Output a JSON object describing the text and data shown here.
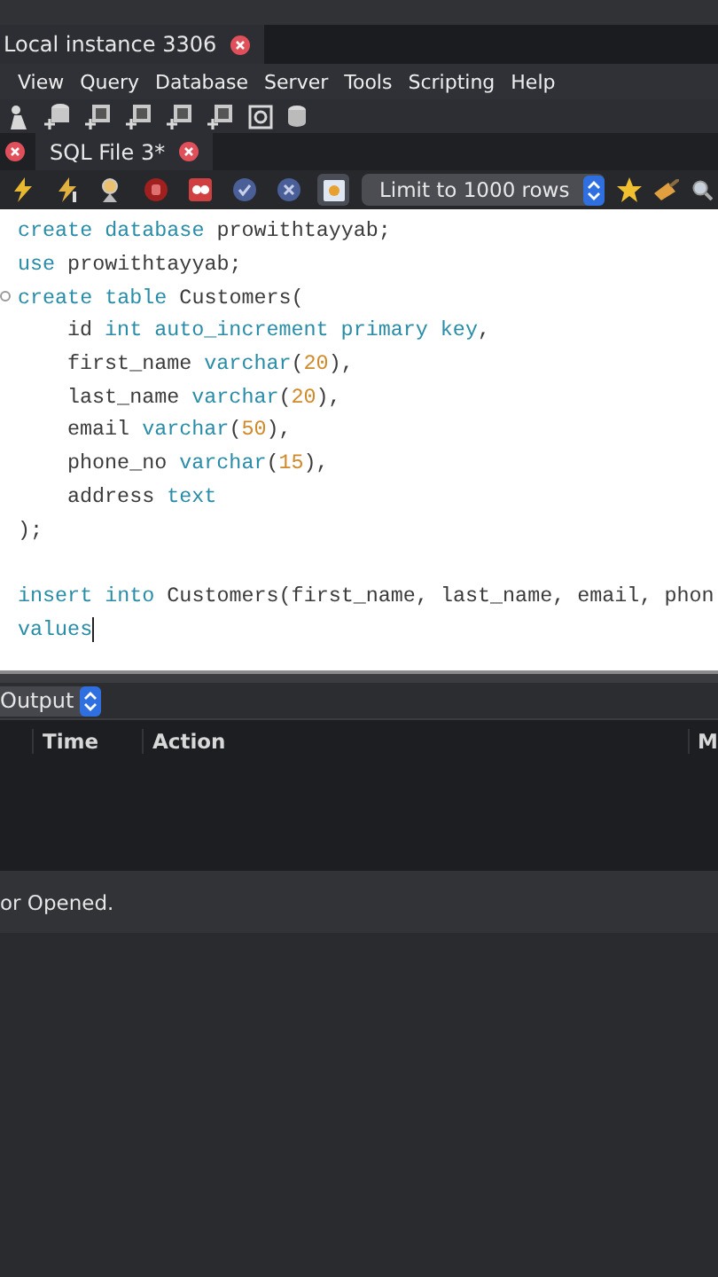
{
  "instance_tab": {
    "title": "Local instance 3306"
  },
  "menu": [
    "View",
    "Query",
    "Database",
    "Server",
    "Tools",
    "Scripting",
    "Help"
  ],
  "main_toolbar": [
    {
      "kind": "person"
    },
    {
      "kind": "db-add"
    },
    {
      "kind": "table-add"
    },
    {
      "kind": "view-add"
    },
    {
      "kind": "proc-add"
    },
    {
      "kind": "func-add"
    },
    {
      "kind": "inspect"
    },
    {
      "kind": "db"
    }
  ],
  "file_tab": {
    "title": "SQL File 3*"
  },
  "editor_toolbar": [
    {
      "kind": "bolt",
      "pressed": false
    },
    {
      "kind": "bolt-cursor",
      "pressed": false
    },
    {
      "kind": "explain",
      "pressed": false
    },
    {
      "kind": "stop",
      "pressed": false
    },
    {
      "kind": "error",
      "pressed": false
    },
    {
      "kind": "commit",
      "pressed": false
    },
    {
      "kind": "rollback",
      "pressed": false
    },
    {
      "kind": "autocommit",
      "pressed": true
    }
  ],
  "limit_select": {
    "value": "Limit to 1000 rows"
  },
  "editor_tools": [
    {
      "kind": "star"
    },
    {
      "kind": "broom"
    },
    {
      "kind": "search"
    }
  ],
  "code": [
    {
      "indent": false,
      "tokens": [
        {
          "kind": "kw",
          "text": "create database"
        },
        {
          "kind": "plain",
          "text": " prowithtayyab;"
        }
      ]
    },
    {
      "indent": false,
      "tokens": [
        {
          "kind": "kw",
          "text": "use"
        },
        {
          "kind": "plain",
          "text": " prowithtayyab;"
        }
      ]
    },
    {
      "indent": false,
      "fold": true,
      "tokens": [
        {
          "kind": "kw",
          "text": "create table"
        },
        {
          "kind": "plain",
          "text": " Customers("
        }
      ]
    },
    {
      "indent": true,
      "tokens": [
        {
          "kind": "plain",
          "text": "id "
        },
        {
          "kind": "kw",
          "text": "int auto_increment primary key"
        },
        {
          "kind": "plain",
          "text": ","
        }
      ]
    },
    {
      "indent": true,
      "tokens": [
        {
          "kind": "plain",
          "text": "first_name "
        },
        {
          "kind": "kw",
          "text": "varchar"
        },
        {
          "kind": "plain",
          "text": "("
        },
        {
          "kind": "num",
          "text": "20"
        },
        {
          "kind": "plain",
          "text": "),"
        }
      ]
    },
    {
      "indent": true,
      "tokens": [
        {
          "kind": "plain",
          "text": "last_name "
        },
        {
          "kind": "kw",
          "text": "varchar"
        },
        {
          "kind": "plain",
          "text": "("
        },
        {
          "kind": "num",
          "text": "20"
        },
        {
          "kind": "plain",
          "text": "),"
        }
      ]
    },
    {
      "indent": true,
      "tokens": [
        {
          "kind": "plain",
          "text": "email "
        },
        {
          "kind": "kw",
          "text": "varchar"
        },
        {
          "kind": "plain",
          "text": "("
        },
        {
          "kind": "num",
          "text": "50"
        },
        {
          "kind": "plain",
          "text": "),"
        }
      ]
    },
    {
      "indent": true,
      "tokens": [
        {
          "kind": "plain",
          "text": "phone_no "
        },
        {
          "kind": "kw",
          "text": "varchar"
        },
        {
          "kind": "plain",
          "text": "("
        },
        {
          "kind": "num",
          "text": "15"
        },
        {
          "kind": "plain",
          "text": "),"
        }
      ]
    },
    {
      "indent": true,
      "tokens": [
        {
          "kind": "plain",
          "text": "address "
        },
        {
          "kind": "kw",
          "text": "text"
        }
      ]
    },
    {
      "indent": false,
      "tokens": [
        {
          "kind": "plain",
          "text": ");"
        }
      ]
    },
    {
      "kind": "blank"
    },
    {
      "indent": false,
      "tokens": [
        {
          "kind": "kw",
          "text": "insert into"
        },
        {
          "kind": "plain",
          "text": " Customers(first_name, last_name, email, phon"
        }
      ]
    },
    {
      "indent": false,
      "cursor": true,
      "tokens": [
        {
          "kind": "kw",
          "text": "values"
        }
      ]
    }
  ],
  "output": {
    "selector": "Output",
    "columns": [
      "Time",
      "Action",
      "M"
    ]
  },
  "status": "or Opened."
}
